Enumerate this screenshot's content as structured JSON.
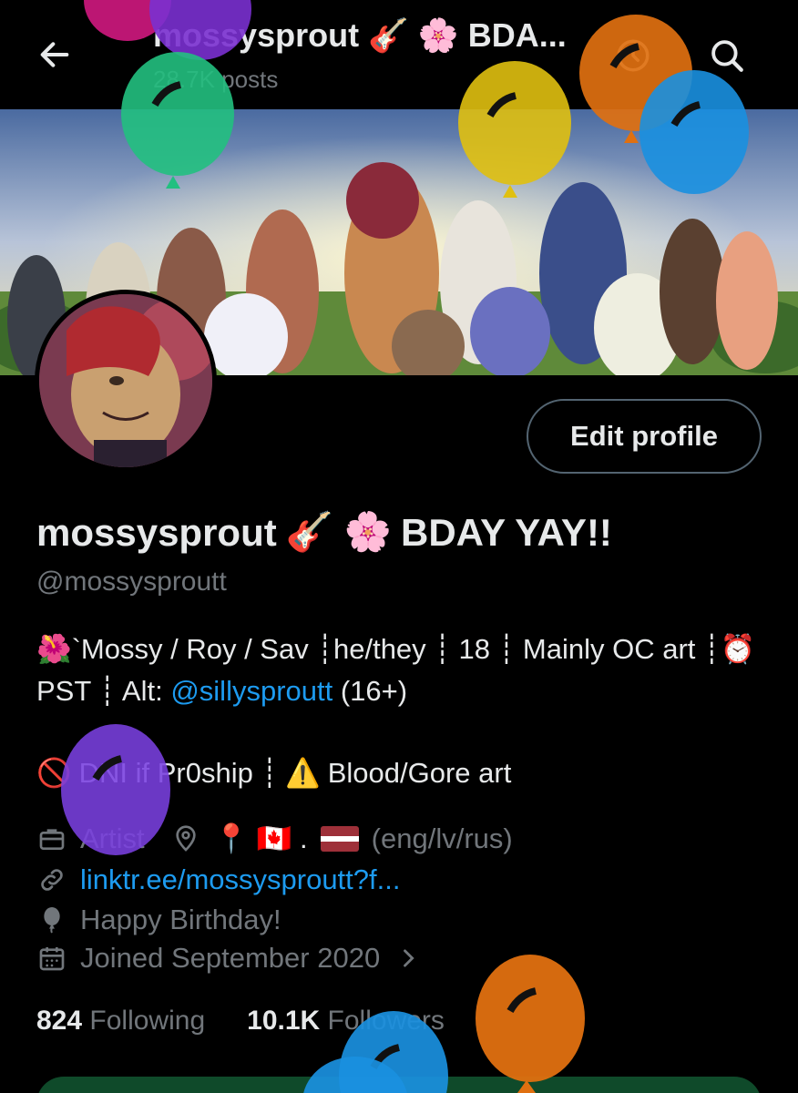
{
  "topbar": {
    "title": "mossysprout 🎸 🌸 BDA...",
    "posts": "28.7K posts"
  },
  "profile": {
    "edit_label": "Edit profile",
    "display_name_text": "mossysprout",
    "display_name_emoji": "🎸 🌸",
    "display_name_suffix": "BDAY YAY!!",
    "handle": "@mossysproutt"
  },
  "bio": {
    "line1_prefix": "🌺`Mossy / Roy / Sav ┊he/they ┊ 18 ┊ Mainly OC art ┊⏰ PST ┊ Alt:",
    "line1_link": "@sillysproutt",
    "line1_suffix": "(16+)",
    "line2_icon": "🚫",
    "line2_text": "DNI if Pr0ship ┊",
    "line2_warn_icon": "⚠️",
    "line2_warn_text": "Blood/Gore art"
  },
  "meta": {
    "profession": "Artist",
    "location_text": "📍 🇨🇦 . ",
    "location_suffix": "(eng/lv/rus)",
    "website": "linktr.ee/mossysproutt?f...",
    "birthday": "Happy Birthday!",
    "joined": "Joined September 2020"
  },
  "stats": {
    "following_count": "824",
    "following_label": "Following",
    "followers_count": "10.1K",
    "followers_label": "Followers"
  },
  "colors": {
    "accent": "#1d9bf0",
    "muted": "#71767b",
    "text": "#e7e9ea",
    "border": "#536471"
  },
  "icons": {
    "back": "arrow-left-icon",
    "clock": "clock-icon",
    "search": "search-icon",
    "briefcase": "briefcase-icon",
    "location": "location-pin-icon",
    "link": "link-icon",
    "balloon": "balloon-icon",
    "calendar": "calendar-icon",
    "chevron": "chevron-right-icon"
  }
}
